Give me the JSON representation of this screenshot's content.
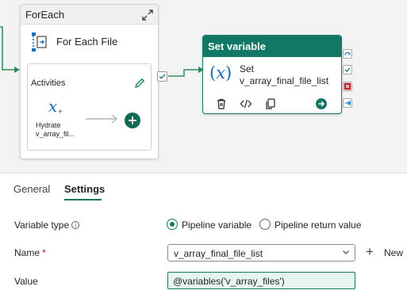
{
  "canvas": {
    "foreach": {
      "title": "ForEach",
      "name": "For Each File",
      "activities_title": "Activities",
      "inner_activity": {
        "icon_text": "x",
        "icon": "variable-icon",
        "label_line1": "Hydrate",
        "label_line2": "v_array_fil..."
      }
    },
    "set_variable": {
      "header": "Set variable",
      "icon": "variable-icon",
      "type_label": "Set",
      "name_label": "v_array_final_file_list"
    },
    "colors": {
      "accent": "#117865",
      "link_green": "#2e8b57",
      "variable_blue": "#0f6cbd",
      "canvas_bg": "#f3f3f3"
    }
  },
  "tabs": [
    {
      "label": "General",
      "active": false
    },
    {
      "label": "Settings",
      "active": true
    }
  ],
  "form": {
    "variable_type": {
      "label": "Variable type",
      "options": [
        {
          "label": "Pipeline variable",
          "checked": true
        },
        {
          "label": "Pipeline return value",
          "checked": false
        }
      ]
    },
    "name": {
      "label": "Name",
      "required_mark": "*",
      "value": "v_array_final_file_list",
      "new_label": "New"
    },
    "value": {
      "label": "Value",
      "text": "@variables('v_array_files')"
    }
  }
}
